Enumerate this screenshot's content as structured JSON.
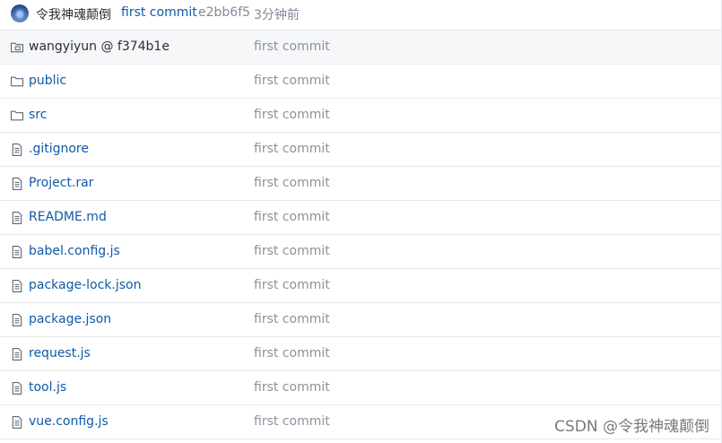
{
  "latest_commit": {
    "author": "令我神魂颠倒",
    "message": "first commit",
    "hash": "e2bb6f5",
    "time": "3分钟前"
  },
  "files": [
    {
      "name": "wangyiyun @ f374b1e",
      "type": "submodule",
      "icon": "submodule-icon",
      "message": "first commit"
    },
    {
      "name": "public",
      "type": "folder",
      "icon": "folder-icon",
      "message": "first commit"
    },
    {
      "name": "src",
      "type": "folder",
      "icon": "folder-icon",
      "message": "first commit"
    },
    {
      "name": ".gitignore",
      "type": "file",
      "icon": "file-icon",
      "message": "first commit"
    },
    {
      "name": "Project.rar",
      "type": "file",
      "icon": "file-icon",
      "message": "first commit"
    },
    {
      "name": "README.md",
      "type": "file",
      "icon": "file-icon",
      "message": "first commit"
    },
    {
      "name": "babel.config.js",
      "type": "file",
      "icon": "file-icon",
      "message": "first commit"
    },
    {
      "name": "package-lock.json",
      "type": "file",
      "icon": "file-icon",
      "message": "first commit"
    },
    {
      "name": "package.json",
      "type": "file",
      "icon": "file-icon",
      "message": "first commit"
    },
    {
      "name": "request.js",
      "type": "file",
      "icon": "file-icon",
      "message": "first commit"
    },
    {
      "name": "tool.js",
      "type": "file",
      "icon": "file-icon",
      "message": "first commit"
    },
    {
      "name": "vue.config.js",
      "type": "file",
      "icon": "file-icon",
      "message": "first commit"
    }
  ],
  "watermark": "CSDN @令我神魂颠倒",
  "colors": {
    "link": "#0e5aa7",
    "muted": "#8b929c",
    "border": "#e6e9ec"
  }
}
